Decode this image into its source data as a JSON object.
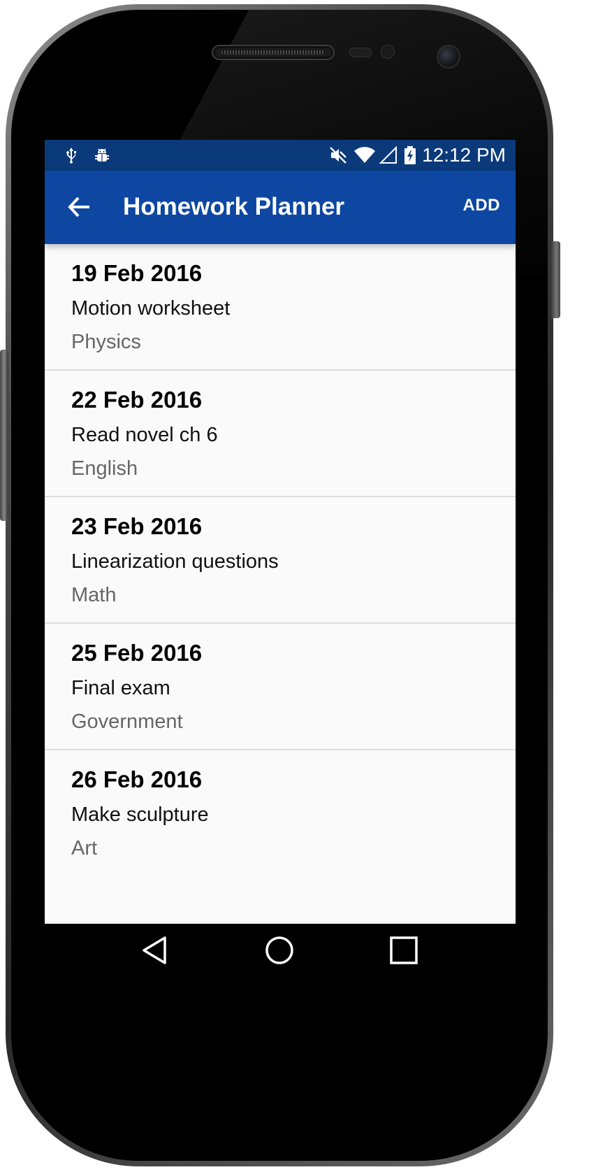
{
  "status_bar": {
    "time": "12:12 PM",
    "left_icons": [
      "usb-icon",
      "android-debug-icon"
    ],
    "right_icons": [
      "mute-icon",
      "wifi-icon",
      "signal-icon",
      "battery-charging-icon"
    ]
  },
  "app_bar": {
    "title": "Homework Planner",
    "add_label": "ADD",
    "back_icon": "arrow-back-icon",
    "color": "#0d47a1"
  },
  "homework": [
    {
      "date": "19 Feb 2016",
      "task": "Motion worksheet",
      "subject": "Physics"
    },
    {
      "date": "22 Feb 2016",
      "task": "Read novel ch 6",
      "subject": "English"
    },
    {
      "date": "23 Feb 2016",
      "task": "Linearization questions",
      "subject": "Math"
    },
    {
      "date": "25 Feb 2016",
      "task": "Final exam",
      "subject": "Government"
    },
    {
      "date": "26 Feb 2016",
      "task": "Make sculpture",
      "subject": "Art"
    }
  ],
  "nav_bar": {
    "icons": [
      "back-triangle-icon",
      "home-circle-icon",
      "recents-square-icon"
    ]
  }
}
